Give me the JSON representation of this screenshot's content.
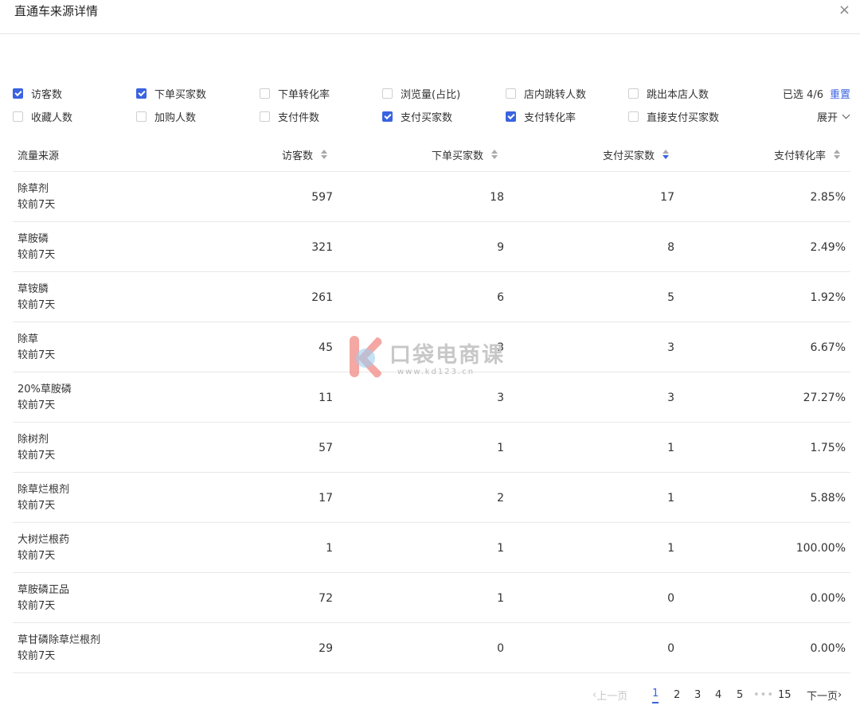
{
  "title": "直通车来源详情",
  "close_icon": "×",
  "filters": {
    "row1": [
      {
        "label": "访客数",
        "checked": true
      },
      {
        "label": "下单买家数",
        "checked": true
      },
      {
        "label": "下单转化率",
        "checked": false
      },
      {
        "label": "浏览量(占比)",
        "checked": false
      },
      {
        "label": "店内跳转人数",
        "checked": false
      },
      {
        "label": "跳出本店人数",
        "checked": false
      }
    ],
    "row2": [
      {
        "label": "收藏人数",
        "checked": false
      },
      {
        "label": "加购人数",
        "checked": false
      },
      {
        "label": "支付件数",
        "checked": false
      },
      {
        "label": "支付买家数",
        "checked": true
      },
      {
        "label": "支付转化率",
        "checked": true
      },
      {
        "label": "直接支付买家数",
        "checked": false
      }
    ],
    "selected_text": "已选 4/6",
    "reset_label": "重置",
    "expand_label": "展开"
  },
  "table": {
    "headers": [
      "流量来源",
      "访客数",
      "下单买家数",
      "支付买家数",
      "支付转化率"
    ],
    "sub_label": "较前7天",
    "rows": [
      {
        "source": "除草剂",
        "sub": "较前7天",
        "visitors": "597",
        "order_buyers": "18",
        "pay_buyers": "17",
        "pay_rate": "2.85%"
      },
      {
        "source": "草胺磷",
        "sub": "较前7天",
        "visitors": "321",
        "order_buyers": "9",
        "pay_buyers": "8",
        "pay_rate": "2.49%"
      },
      {
        "source": "草铵膦",
        "sub": "较前7天",
        "visitors": "261",
        "order_buyers": "6",
        "pay_buyers": "5",
        "pay_rate": "1.92%"
      },
      {
        "source": "除草",
        "sub": "较前7天",
        "visitors": "45",
        "order_buyers": "3",
        "pay_buyers": "3",
        "pay_rate": "6.67%"
      },
      {
        "source": "20%草胺磷",
        "sub": "较前7天",
        "visitors": "11",
        "order_buyers": "3",
        "pay_buyers": "3",
        "pay_rate": "27.27%"
      },
      {
        "source": "除树剂",
        "sub": "较前7天",
        "visitors": "57",
        "order_buyers": "1",
        "pay_buyers": "1",
        "pay_rate": "1.75%"
      },
      {
        "source": "除草烂根剂",
        "sub": "较前7天",
        "visitors": "17",
        "order_buyers": "2",
        "pay_buyers": "1",
        "pay_rate": "5.88%"
      },
      {
        "source": "大树烂根药",
        "sub": "较前7天",
        "visitors": "1",
        "order_buyers": "1",
        "pay_buyers": "1",
        "pay_rate": "100.00%"
      },
      {
        "source": "草胺磷正品",
        "sub": "较前7天",
        "visitors": "72",
        "order_buyers": "1",
        "pay_buyers": "0",
        "pay_rate": "0.00%"
      },
      {
        "source": "草甘磷除草烂根剂",
        "sub": "较前7天",
        "visitors": "29",
        "order_buyers": "0",
        "pay_buyers": "0",
        "pay_rate": "0.00%"
      }
    ]
  },
  "pagination": {
    "prev": "上一页",
    "pages": [
      "1",
      "2",
      "3",
      "4",
      "5"
    ],
    "ellipsis": "•••",
    "last": "15",
    "next": "下一页",
    "current": "1"
  },
  "watermark": {
    "text": "口袋电商课",
    "url": "www.kd123.cn"
  },
  "colors": {
    "accent": "#3a63e0",
    "watermark_k": "#f08a84"
  }
}
